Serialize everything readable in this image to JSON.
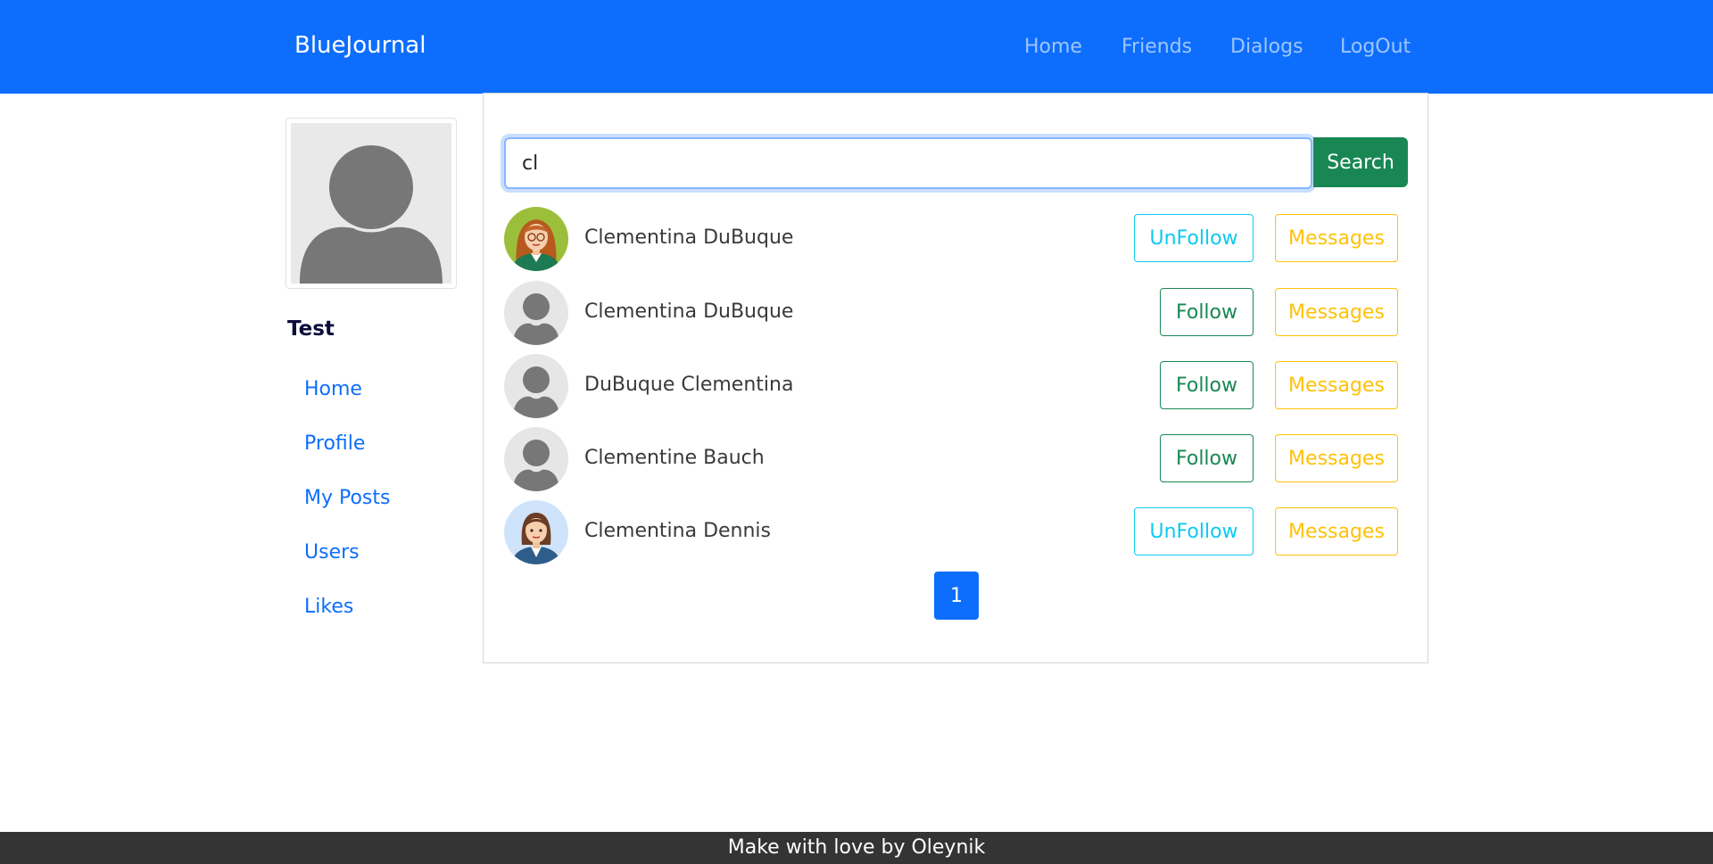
{
  "navbar": {
    "brand": "BlueJournal",
    "links": [
      "Home",
      "Friends",
      "Dialogs",
      "LogOut"
    ],
    "background_color": "#0d6efd"
  },
  "sidebar": {
    "username": "Test",
    "menu": [
      "Home",
      "Profile",
      "My Posts",
      "Users",
      "Likes"
    ]
  },
  "search": {
    "value": "cl",
    "button_label": "Search"
  },
  "users": [
    {
      "name": "Clementina DuBuque",
      "avatar": "woman-glasses-avatar",
      "follow_label": "UnFollow",
      "messages_label": "Messages"
    },
    {
      "name": "Clementina DuBuque",
      "avatar": "default-avatar",
      "follow_label": "Follow",
      "messages_label": "Messages"
    },
    {
      "name": "DuBuque Clementina",
      "avatar": "default-avatar",
      "follow_label": "Follow",
      "messages_label": "Messages"
    },
    {
      "name": "Clementine Bauch",
      "avatar": "default-avatar",
      "follow_label": "Follow",
      "messages_label": "Messages"
    },
    {
      "name": "Clementina Dennis",
      "avatar": "woman-suit-avatar",
      "follow_label": "UnFollow",
      "messages_label": "Messages"
    }
  ],
  "pagination": {
    "current_page": "1"
  },
  "footer": {
    "text": "Make with love by Oleynik"
  },
  "colors": {
    "primary": "#0d6efd",
    "success": "#198754",
    "info": "#0dcaf0",
    "warning": "#ffc107",
    "footer_bg": "#343434"
  }
}
